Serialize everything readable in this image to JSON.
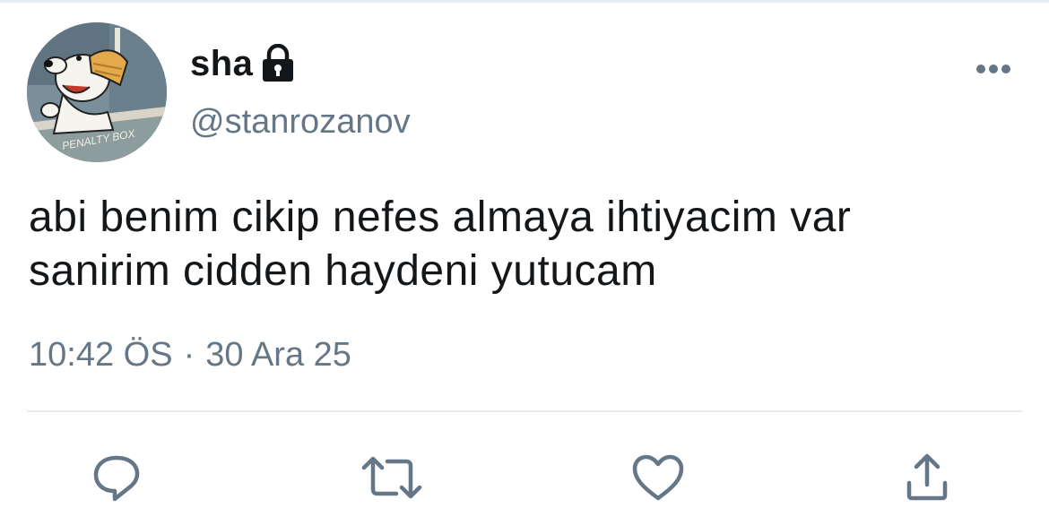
{
  "user": {
    "display_name": "sha",
    "handle": "@stanrozanov",
    "protected": true,
    "avatar_sign_text": "PENALTY BOX"
  },
  "tweet": {
    "text_line1": "abi benim cikip nefes almaya ihtiyacim var",
    "text_line2": "sanirim cidden haydeni yutucam",
    "time": "10:42 ÖS",
    "separator": "·",
    "date": "30 Ara 25"
  },
  "icons": {
    "more": "more-horizontal-icon",
    "lock": "lock-icon",
    "reply": "reply-icon",
    "retweet": "retweet-icon",
    "like": "heart-icon",
    "share": "share-icon"
  },
  "colors": {
    "text": "#14171a",
    "secondary": "#657786",
    "divider": "#e6ecf0"
  }
}
